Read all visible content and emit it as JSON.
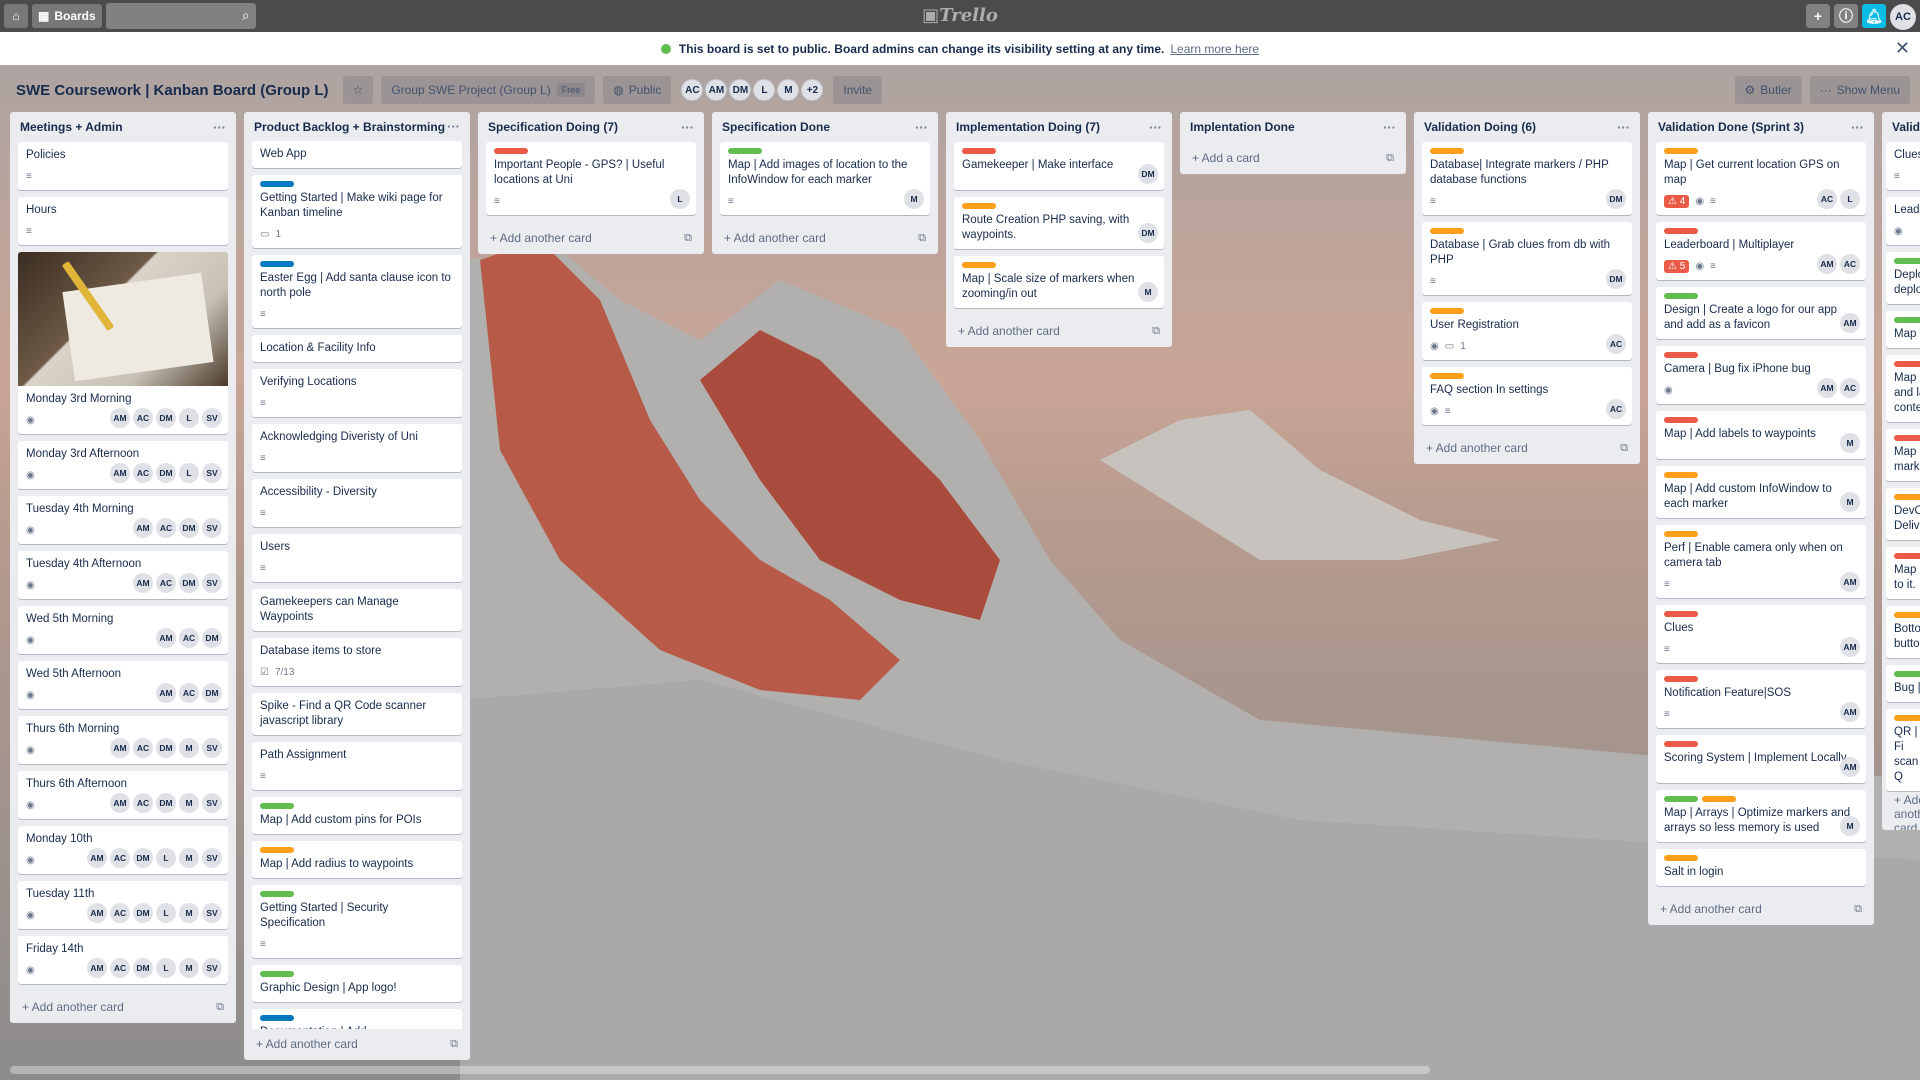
{
  "colors": {
    "green": "#61bd4f",
    "red": "#eb5a46",
    "orange": "#ff9f1a",
    "blue": "#0079bf",
    "yellow": "#f2d600"
  },
  "header": {
    "boards_label": "Boards",
    "logo_text": "Trello",
    "user_initials": "AC"
  },
  "notice": {
    "text": "This board is set to public. Board admins can change its visibility setting at any time.",
    "link": "Learn more here"
  },
  "board": {
    "title": "SWE Coursework | Kanban Board (Group L)",
    "team": "Group SWE Project (Group L)",
    "team_badge": "Free",
    "visibility": "Public",
    "members": [
      "AC",
      "AM",
      "DM",
      "L",
      "M"
    ],
    "members_more": "+2",
    "invite": "Invite",
    "butler": "Butler",
    "show_menu": "Show Menu"
  },
  "add_card_label": "Add another card",
  "add_card_first": "Add a card",
  "lists": [
    {
      "title": "Meetings + Admin",
      "cards": [
        {
          "title": "Policies",
          "desc": true
        },
        {
          "title": "Hours",
          "desc": true
        },
        {
          "title": "Monday 3rd Morning",
          "image": true,
          "watch": true,
          "avatars": [
            "AM",
            "AC",
            "DM",
            "L",
            "SV"
          ]
        },
        {
          "title": "Monday 3rd Afternoon",
          "watch": true,
          "avatars": [
            "AM",
            "AC",
            "DM",
            "L",
            "SV"
          ]
        },
        {
          "title": "Tuesday 4th Morning",
          "watch": true,
          "avatars": [
            "AM",
            "AC",
            "DM",
            "SV"
          ]
        },
        {
          "title": "Tuesday 4th Afternoon",
          "watch": true,
          "avatars": [
            "AM",
            "AC",
            "DM",
            "SV"
          ]
        },
        {
          "title": "Wed 5th Morning",
          "watch": true,
          "avatars": [
            "AM",
            "AC",
            "DM"
          ]
        },
        {
          "title": "Wed 5th Afternoon",
          "watch": true,
          "avatars": [
            "AM",
            "AC",
            "DM"
          ]
        },
        {
          "title": "Thurs 6th Morning",
          "watch": true,
          "avatars": [
            "AM",
            "AC",
            "DM",
            "M",
            "SV"
          ]
        },
        {
          "title": "Thurs 6th Afternoon",
          "watch": true,
          "avatars": [
            "AM",
            "AC",
            "DM",
            "M",
            "SV"
          ]
        },
        {
          "title": "Monday 10th",
          "watch": true,
          "avatars": [
            "AM",
            "AC",
            "DM",
            "L",
            "M",
            "SV"
          ]
        },
        {
          "title": "Tuesday 11th",
          "watch": true,
          "avatars": [
            "AM",
            "AC",
            "DM",
            "L",
            "M",
            "SV"
          ]
        },
        {
          "title": "Friday 14th",
          "watch": true,
          "avatars": [
            "AM",
            "AC",
            "DM",
            "L",
            "M",
            "SV"
          ]
        }
      ]
    },
    {
      "title": "Product Backlog + Brainstorming",
      "cards": [
        {
          "title": "Web App"
        },
        {
          "labels": [
            "blue"
          ],
          "title": "Getting Started | Make wiki page for Kanban timeline",
          "comments": "1"
        },
        {
          "labels": [
            "blue"
          ],
          "title": "Easter Egg | Add santa clause icon to north pole",
          "desc": true
        },
        {
          "title": "Location & Facility Info"
        },
        {
          "title": "Verifying Locations",
          "desc": true
        },
        {
          "title": "Acknowledging Diveristy of Uni",
          "desc": true
        },
        {
          "title": "Accessibility - Diversity",
          "desc": true
        },
        {
          "title": "Users",
          "desc": true
        },
        {
          "title": "Gamekeepers can Manage Waypoints"
        },
        {
          "title": "Database items to store",
          "checklist": "7/13"
        },
        {
          "title": "Spike - Find a QR Code scanner javascript library"
        },
        {
          "title": "Path Assignment",
          "desc": true
        },
        {
          "labels": [
            "green"
          ],
          "title": "Map | Add custom pins for POIs"
        },
        {
          "labels": [
            "orange"
          ],
          "title": "Map | Add radius to waypoints"
        },
        {
          "labels": [
            "green"
          ],
          "title": "Getting Started | Security Specification",
          "desc": true
        },
        {
          "labels": [
            "green"
          ],
          "title": "Graphic Design | App logo!"
        },
        {
          "labels": [
            "blue"
          ],
          "title": "Documentation | Add"
        }
      ]
    },
    {
      "title": "Specification Doing (7)",
      "cards": [
        {
          "labels": [
            "red"
          ],
          "title": "Important People - GPS? | Useful locations at Uni",
          "desc": true,
          "avatars": [
            "L"
          ]
        }
      ]
    },
    {
      "title": "Specification Done",
      "cards": [
        {
          "labels": [
            "green"
          ],
          "title": "Map | Add images of location to the InfoWindow for each marker",
          "desc": true,
          "avatars": [
            "M"
          ]
        }
      ]
    },
    {
      "title": "Implementation Doing (7)",
      "cards": [
        {
          "labels": [
            "red"
          ],
          "title": "Gamekeeper | Make interface",
          "avatars": [
            "DM"
          ]
        },
        {
          "labels": [
            "orange"
          ],
          "title": "Route Creation PHP saving, with waypoints.",
          "avatars": [
            "DM"
          ]
        },
        {
          "labels": [
            "orange"
          ],
          "title": "Map | Scale size of markers when zooming/in out",
          "avatars": [
            "M"
          ]
        }
      ]
    },
    {
      "title": "Implentation Done",
      "cards": [],
      "first": true
    },
    {
      "title": "Validation Doing (6)",
      "cards": [
        {
          "labels": [
            "orange"
          ],
          "title": "Database| Integrate markers / PHP database functions",
          "desc": true,
          "avatars": [
            "DM"
          ]
        },
        {
          "labels": [
            "orange"
          ],
          "title": "Database | Grab clues from db with PHP",
          "desc": true,
          "avatars": [
            "DM"
          ]
        },
        {
          "labels": [
            "orange"
          ],
          "title": "User Registration",
          "watch": true,
          "comments": "1",
          "avatars": [
            "AC"
          ]
        },
        {
          "labels": [
            "orange"
          ],
          "title": "FAQ section In settings",
          "watch": true,
          "desc": true,
          "avatars": [
            "AC"
          ]
        }
      ]
    },
    {
      "title": "Validation Done (Sprint 3)",
      "cards": [
        {
          "labels": [
            "orange"
          ],
          "title": "Map | Get current location GPS on map",
          "alert": "4",
          "watch": true,
          "desc": true,
          "avatars": [
            "AC",
            "L"
          ]
        },
        {
          "labels": [
            "red"
          ],
          "title": "Leaderboard | Multiplayer",
          "alert": "5",
          "watch": true,
          "desc": true,
          "avatars": [
            "AM",
            "AC"
          ]
        },
        {
          "labels": [
            "green"
          ],
          "title": "Design | Create a logo for our app and add as a favicon",
          "avatars": [
            "AM"
          ]
        },
        {
          "labels": [
            "red"
          ],
          "title": "Camera | Bug fix iPhone bug",
          "watch": true,
          "avatars": [
            "AM",
            "AC"
          ]
        },
        {
          "labels": [
            "red"
          ],
          "title": "Map | Add labels to waypoints",
          "avatars": [
            "M"
          ]
        },
        {
          "labels": [
            "orange"
          ],
          "title": "Map | Add custom InfoWindow to each marker",
          "avatars": [
            "M"
          ]
        },
        {
          "labels": [
            "orange"
          ],
          "title": "Perf | Enable camera only when on camera tab",
          "desc": true,
          "avatars": [
            "AM"
          ]
        },
        {
          "labels": [
            "red"
          ],
          "title": "Clues",
          "desc": true,
          "avatars": [
            "AM"
          ]
        },
        {
          "labels": [
            "red"
          ],
          "title": "Notification Feature|SOS",
          "desc": true,
          "avatars": [
            "AM"
          ]
        },
        {
          "labels": [
            "red"
          ],
          "title": "Scoring System | Implement Locally",
          "avatars": [
            "AM"
          ]
        },
        {
          "labels": [
            "green",
            "orange"
          ],
          "title": "Map | Arrays | Optimize markers and arrays so less memory is used",
          "avatars": [
            "M"
          ]
        },
        {
          "labels": [
            "orange"
          ],
          "title": "Salt in login"
        }
      ]
    },
    {
      "title": "Valida",
      "partial": true,
      "cards": [
        {
          "title": "Clues",
          "desc": true
        },
        {
          "title": "Leader",
          "watch": true
        },
        {
          "labels": [
            "green"
          ],
          "title": "Deploy deploy"
        },
        {
          "labels": [
            "green"
          ],
          "title": "Map |"
        },
        {
          "labels": [
            "red"
          ],
          "title": "Map | and lal conter"
        },
        {
          "labels": [
            "red"
          ],
          "title": "Map | marke"
        },
        {
          "labels": [
            "orange"
          ],
          "title": "DevOp Delive"
        },
        {
          "labels": [
            "red"
          ],
          "title": "Map | to it."
        },
        {
          "labels": [
            "orange"
          ],
          "title": "Bottor buttor"
        },
        {
          "labels": [
            "green"
          ],
          "title": "Bug | I"
        },
        {
          "labels": [
            "orange"
          ],
          "title": "QR | Fi scan Q"
        }
      ]
    }
  ]
}
